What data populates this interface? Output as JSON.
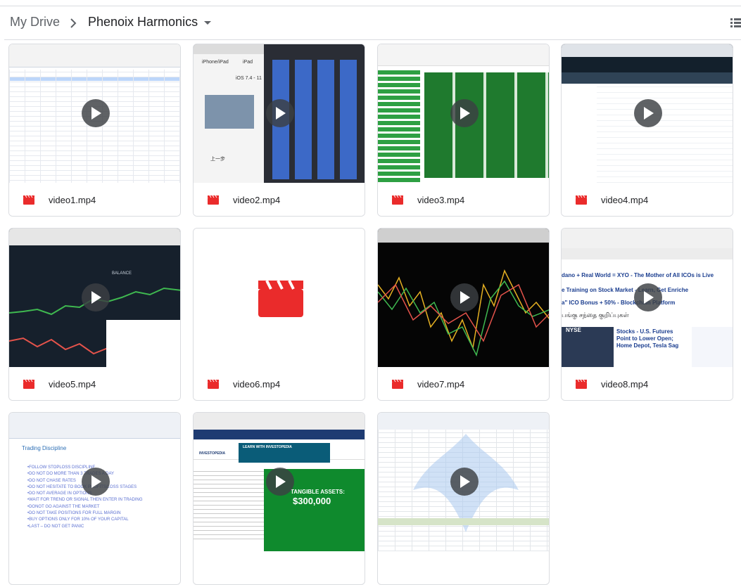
{
  "breadcrumb": {
    "root": "My Drive",
    "current": "Phenoix Harmonics"
  },
  "colors": {
    "video_icon": "#ea2b2b",
    "play_bg": "#3c4043"
  },
  "files": [
    {
      "name": "video1.mp4",
      "type": "video",
      "has_preview": true
    },
    {
      "name": "video2.mp4",
      "type": "video",
      "has_preview": true
    },
    {
      "name": "video3.mp4",
      "type": "video",
      "has_preview": true
    },
    {
      "name": "video4.mp4",
      "type": "video",
      "has_preview": true
    },
    {
      "name": "video5.mp4",
      "type": "video",
      "has_preview": true
    },
    {
      "name": "video6.mp4",
      "type": "video",
      "has_preview": false
    },
    {
      "name": "video7.mp4",
      "type": "video",
      "has_preview": true
    },
    {
      "name": "video8.mp4",
      "type": "video",
      "has_preview": true
    },
    {
      "name": "",
      "type": "video",
      "has_preview": true
    },
    {
      "name": "",
      "type": "video",
      "has_preview": true
    },
    {
      "name": "",
      "type": "video",
      "has_preview": true
    }
  ],
  "thumbnails": {
    "video2": {
      "tab1": "iPhone/iPad",
      "tab2": "iPad",
      "title": "iOS 7.4 - 11",
      "back": "上一步"
    },
    "video5": {
      "label": "BALANCE"
    },
    "video8": {
      "headline1": "dano + Real World = XYO - The Mother of All ICOs is Live",
      "headline2": "e Training on Stock Market - Learn, Get Enriche",
      "headline3": "a\" ICO Bonus + 50% - Blockchain   Platform",
      "tamil": "பங்கு சந்தை குறிப்புகள்",
      "ticker": "NYSE",
      "news_title": "Stocks - U.S. Futures Point to Lower Open; Home Depot, Tesla Sag"
    },
    "video9": {
      "heading": "Trading Discipline",
      "rules": [
        "•FOLLOW STOPLOSS DISCIPLINE",
        "•DO NOT DO MORE THAN 3 TRADES A DAY",
        "•DO NOT CHASE RATES",
        "•DO NOT HESITATE TO BOOK PROFITS/LOSS STAGES",
        "•DO NOT AVERAGE IN OPTIONS",
        "•WAIT FOR TREND OR SIGNAL THEN ENTER IN TRADING",
        "•DONOT GO AGAINST THE MARKET",
        "•DO NOT TAKE POSITIONS FOR FULL MARGIN",
        "•BUY OPTIONS ONLY FOR 10% OF YOUR CAPITAL",
        "•LAST – DO NOT GET PANIC"
      ]
    },
    "video10": {
      "banner": "LEARN WITH INVESTOPEDIA",
      "brand": "INVESTOPEDIA",
      "assets_label": "TANGIBLE ASSETS:",
      "assets_value": "$300,000"
    }
  }
}
